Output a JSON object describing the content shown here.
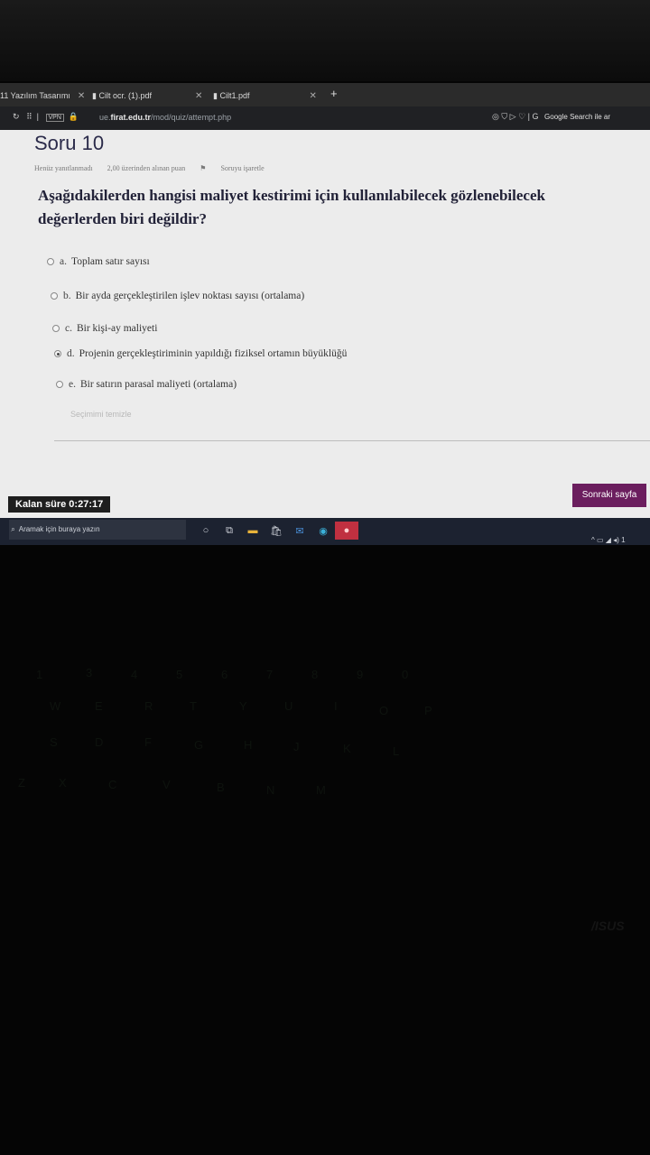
{
  "browser": {
    "tabs": [
      {
        "label": "11 Yazılım Tasarımı"
      },
      {
        "label": "Cilt ocr. (1).pdf"
      },
      {
        "label": "Cilt1.pdf"
      }
    ],
    "new_tab": "+",
    "url_prefix": "ue.",
    "url_domain": "firat.edu.tr",
    "url_path": "/mod/quiz/attempt.php",
    "search_label": "Google Search ile ar"
  },
  "quiz": {
    "question_number": "Soru 10",
    "status": "Henüz yanıtlanmadı",
    "points": "2,00 üzerinden alınan puan",
    "flag_label": "Soruyu işaretle",
    "question_line1": "Aşağıdakilerden hangisi maliyet kestirimi için kullanılabilecek gözlenebilecek",
    "question_line2": "değerlerden biri değildir?",
    "options": [
      {
        "letter": "a.",
        "text": "Toplam satır sayısı",
        "checked": false
      },
      {
        "letter": "b.",
        "text": "Bir ayda gerçekleştirilen işlev noktası sayısı (ortalama)",
        "checked": false
      },
      {
        "letter": "c.",
        "text": "Bir kişi-ay maliyeti",
        "checked": false
      },
      {
        "letter": "d.",
        "text": "Projenin gerçekleştiriminin yapıldığı fiziksel ortamın büyüklüğü",
        "checked": true
      },
      {
        "letter": "e.",
        "text": "Bir satırın parasal maliyeti (ortalama)",
        "checked": false
      }
    ],
    "clear_choice": "Seçimimi temizle",
    "next_button": "Sonraki sayfa",
    "timer": "Kalan süre 0:27:17"
  },
  "taskbar": {
    "search_placeholder": "Aramak için buraya yazın",
    "clock_fragment": "1"
  },
  "keyboard": {
    "brand": "/ISUS"
  }
}
